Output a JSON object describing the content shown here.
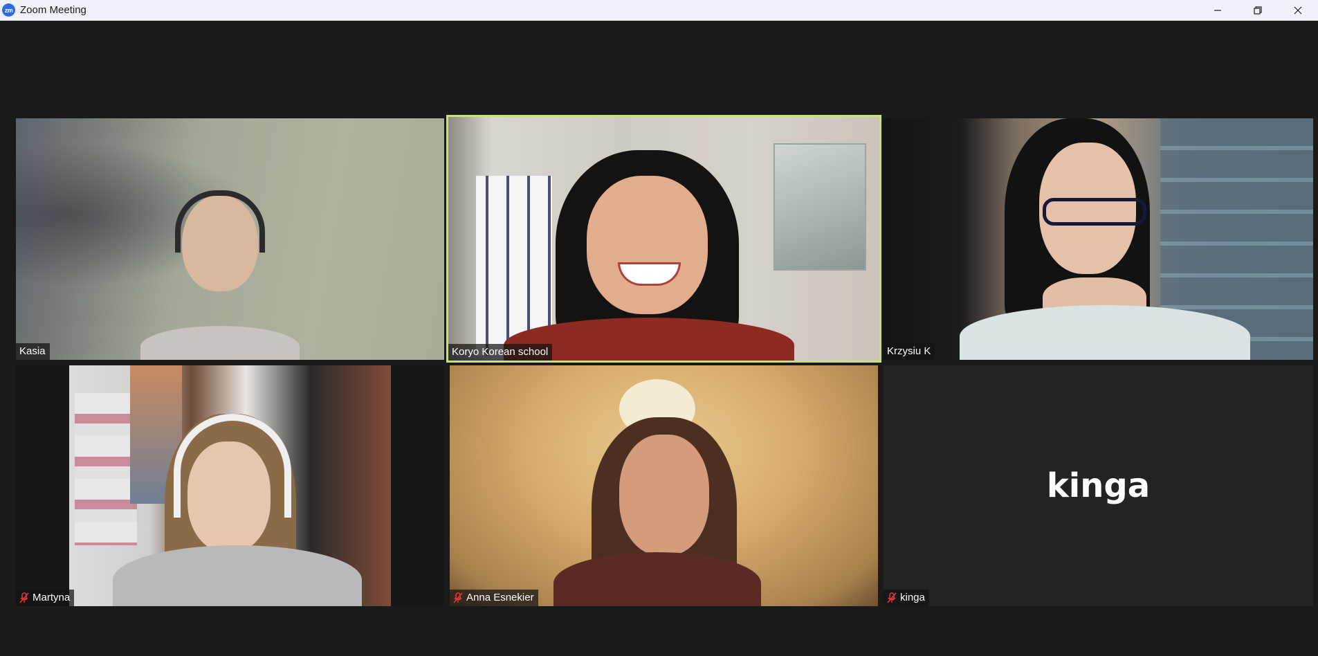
{
  "window": {
    "title": "Zoom Meeting",
    "logo_text": "zm",
    "controls": [
      "minimize",
      "restore",
      "close"
    ]
  },
  "participants": [
    {
      "name": "Kasia",
      "muted": false,
      "video": true,
      "speaking": false
    },
    {
      "name": "Koryo Korean school",
      "muted": false,
      "video": true,
      "speaking": true
    },
    {
      "name": "Krzysiu K",
      "muted": false,
      "video": true,
      "speaking": false
    },
    {
      "name": "Martyna",
      "muted": true,
      "video": true,
      "speaking": false
    },
    {
      "name": "Anna Esnekier",
      "muted": true,
      "video": true,
      "speaking": false
    },
    {
      "name": "kinga",
      "muted": true,
      "video": false,
      "speaking": false,
      "avatar_text": "kinga"
    }
  ],
  "colors": {
    "background": "#1a1a1a",
    "active_speaker_border": "#c6e66b",
    "muted_icon": "#e0383e"
  }
}
